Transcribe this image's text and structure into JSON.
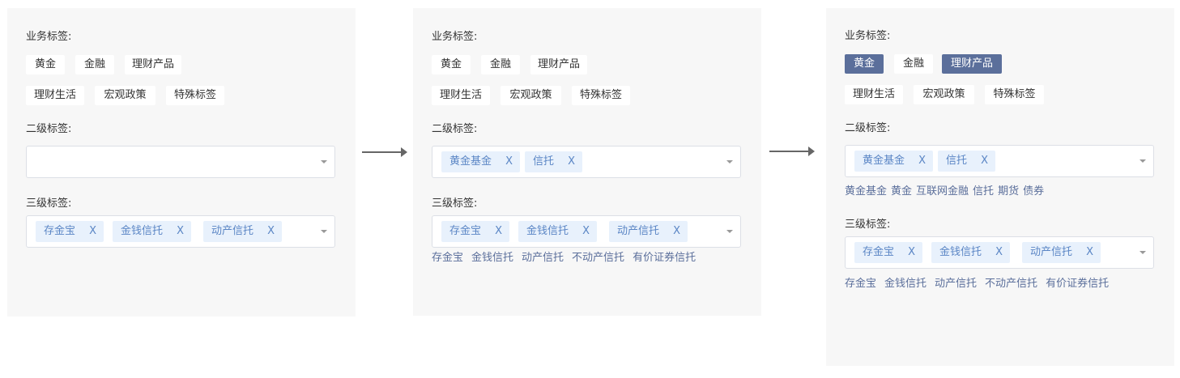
{
  "labels": {
    "business": "业务标签:",
    "level2": "二级标签:",
    "level3": "三级标签:"
  },
  "tag_close": "X",
  "business_tags": [
    "黄金",
    "金融",
    "理财产品",
    "理财生活",
    "宏观政策",
    "特殊标签"
  ],
  "panels": [
    {
      "selected_business": [],
      "level2_selected": [],
      "level2_options": [],
      "level3_selected": [
        "存金宝",
        "金钱信托",
        "动产信托"
      ],
      "level3_options": []
    },
    {
      "selected_business": [],
      "level2_selected": [
        "黄金基金",
        "信托"
      ],
      "level2_options": [],
      "level3_selected": [
        "存金宝",
        "金钱信托",
        "动产信托"
      ],
      "level3_options": [
        "存金宝",
        "金钱信托",
        "动产信托",
        "不动产信托",
        "有价证券信托"
      ]
    },
    {
      "selected_business": [
        "黄金",
        "理财产品"
      ],
      "level2_selected": [
        "黄金基金",
        "信托"
      ],
      "level2_options": [
        "黄金基金",
        "黄金",
        "互联网金融",
        "信托",
        "期货",
        "债券"
      ],
      "level3_selected": [
        "存金宝",
        "金钱信托",
        "动产信托"
      ],
      "level3_options": [
        "存金宝",
        "金钱信托",
        "动产信托",
        "不动产信托",
        "有价证券信托"
      ]
    }
  ],
  "colors": {
    "panel_bg": "#f7f7f7",
    "chip_selected_bg": "#5b6f9b",
    "tag_bg": "#e8f1fc",
    "tag_text": "#5b86c5",
    "option_text": "#5b6f9b",
    "arrow": "#666666"
  },
  "icons": {
    "dropdown": "caret-down-icon",
    "flow": "arrow-right-icon",
    "tag_remove": "close-icon"
  }
}
